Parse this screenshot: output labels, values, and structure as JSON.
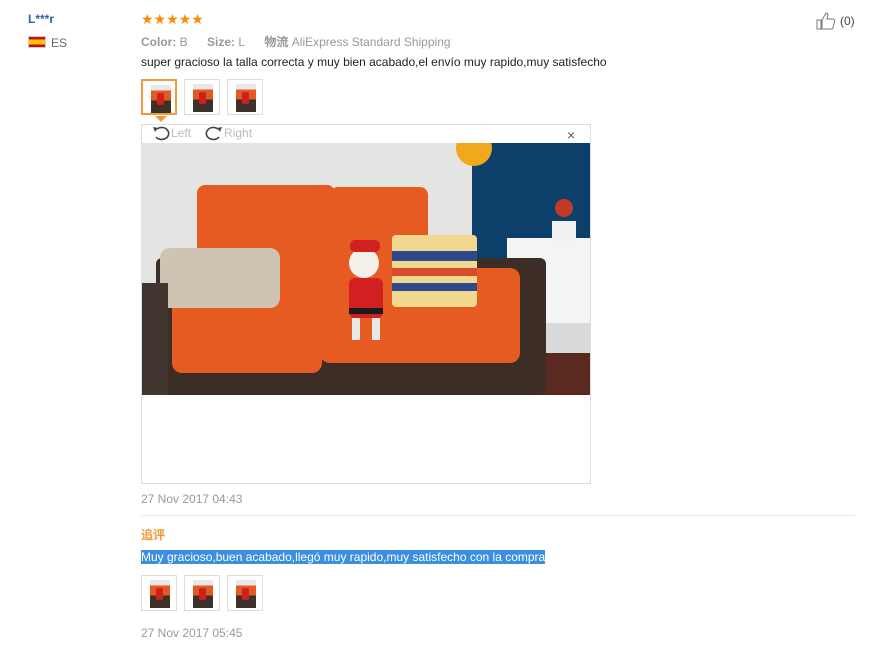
{
  "reviewer": {
    "name": "L***r",
    "country": "ES"
  },
  "rating": {
    "stars": "★★★★★",
    "color": "#ff8a00"
  },
  "helpful": {
    "count": "(0)"
  },
  "meta": {
    "color_label": "Color:",
    "color_value": "B",
    "size_label": "Size:",
    "size_value": "L",
    "shipping_label": "物流",
    "shipping_value": "AliExpress Standard Shipping"
  },
  "review_text": "super gracioso la talla correcta y muy bien acabado,el envío muy rapido,muy satisfecho",
  "viewer": {
    "left_label": "Left",
    "right_label": "Right",
    "close": "×"
  },
  "date1": "27 Nov 2017 04:43",
  "append_label": "追评",
  "review_text_2": "Muy gracioso,buen acabado,llegó muy rapido,muy satisfecho con la compra",
  "date2": "27 Nov 2017 05:45",
  "colors": {
    "accent": "#f29a3b",
    "link": "#2f5fa7",
    "selection": "#3b8fe0"
  }
}
